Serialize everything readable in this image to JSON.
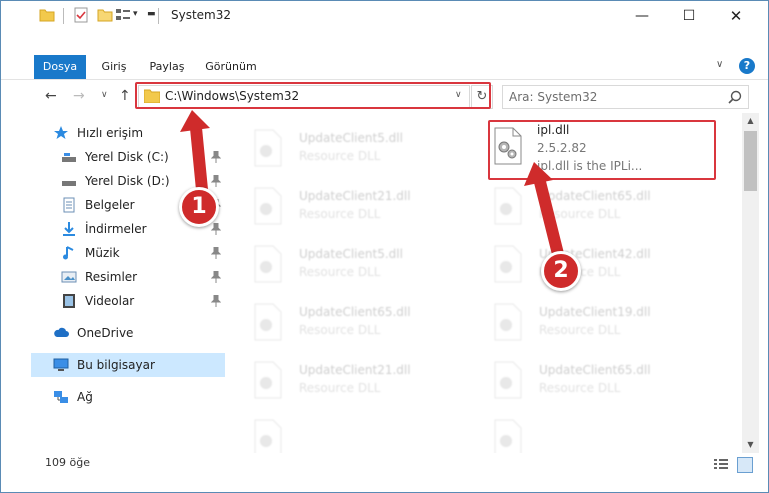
{
  "window": {
    "title": "System32"
  },
  "ribbon": {
    "tabs": [
      "Dosya",
      "Giriş",
      "Paylaş",
      "Görünüm"
    ]
  },
  "address": {
    "path": "C:\\Windows\\System32"
  },
  "search": {
    "placeholder": "Ara: System32"
  },
  "navpane": {
    "items": [
      {
        "label": "Hızlı erişim",
        "icon": "star-icon"
      },
      {
        "label": "Yerel Disk (C:)",
        "icon": "drive-icon",
        "pinned": true
      },
      {
        "label": "Yerel Disk (D:)",
        "icon": "drive-icon",
        "pinned": true
      },
      {
        "label": "Belgeler",
        "icon": "document-icon",
        "pinned": true
      },
      {
        "label": "İndirmeler",
        "icon": "download-icon",
        "pinned": true
      },
      {
        "label": "Müzik",
        "icon": "music-icon",
        "pinned": true
      },
      {
        "label": "Resimler",
        "icon": "pictures-icon",
        "pinned": true
      },
      {
        "label": "Videolar",
        "icon": "video-icon",
        "pinned": true
      },
      {
        "label": "OneDrive",
        "icon": "cloud-icon"
      },
      {
        "label": "Bu bilgisayar",
        "icon": "computer-icon",
        "selected": true
      },
      {
        "label": "Ağ",
        "icon": "network-icon"
      }
    ]
  },
  "files": {
    "primary": {
      "name": "ipl.dll",
      "version": "2.5.2.82",
      "description": "ipl.dll is the IPLi..."
    },
    "left_column": [
      {
        "name": "UpdateClient5.dll",
        "desc": "Resource DLL"
      },
      {
        "name": "UpdateClient21.dll",
        "desc": "Resource DLL"
      },
      {
        "name": "UpdateClient5.dll",
        "desc": "Resource DLL"
      },
      {
        "name": "UpdateClient65.dll",
        "desc": "Resource DLL"
      },
      {
        "name": "UpdateClient21.dll",
        "desc": "Resource DLL"
      },
      {
        "name": "",
        "desc": ""
      }
    ],
    "right_column": [
      {
        "name": "UpdateClient65.dll",
        "desc": "Resource DLL"
      },
      {
        "name": "UpdateClient42.dll",
        "desc": "Resource DLL"
      },
      {
        "name": "UpdateClient19.dll",
        "desc": "Resource DLL"
      },
      {
        "name": "UpdateClient65.dll",
        "desc": "Resource DLL"
      },
      {
        "name": "",
        "desc": ""
      }
    ]
  },
  "status": {
    "count": "109 öğe"
  },
  "annotations": {
    "badge1": "1",
    "badge2": "2"
  },
  "colors": {
    "accent": "#1979ca",
    "highlight": "#d9363e",
    "selected_bg": "#cce8ff"
  }
}
